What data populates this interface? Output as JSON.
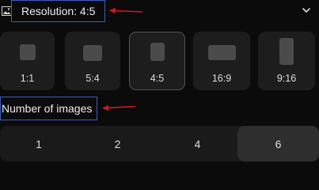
{
  "resolution": {
    "label": "Resolution: 4:5",
    "icon": "image-icon",
    "expand_icon": "chevron-down-icon",
    "highlight_color": "#3b5fc0",
    "arrow_color": "#d11a1a"
  },
  "ratios": [
    {
      "label": "1:1",
      "selected": false
    },
    {
      "label": "5:4",
      "selected": false
    },
    {
      "label": "4:5",
      "selected": true
    },
    {
      "label": "16:9",
      "selected": false
    },
    {
      "label": "9:16",
      "selected": false
    }
  ],
  "number_of_images": {
    "label": "Number of images",
    "options": [
      "1",
      "2",
      "4",
      "6"
    ],
    "selected": "6"
  }
}
